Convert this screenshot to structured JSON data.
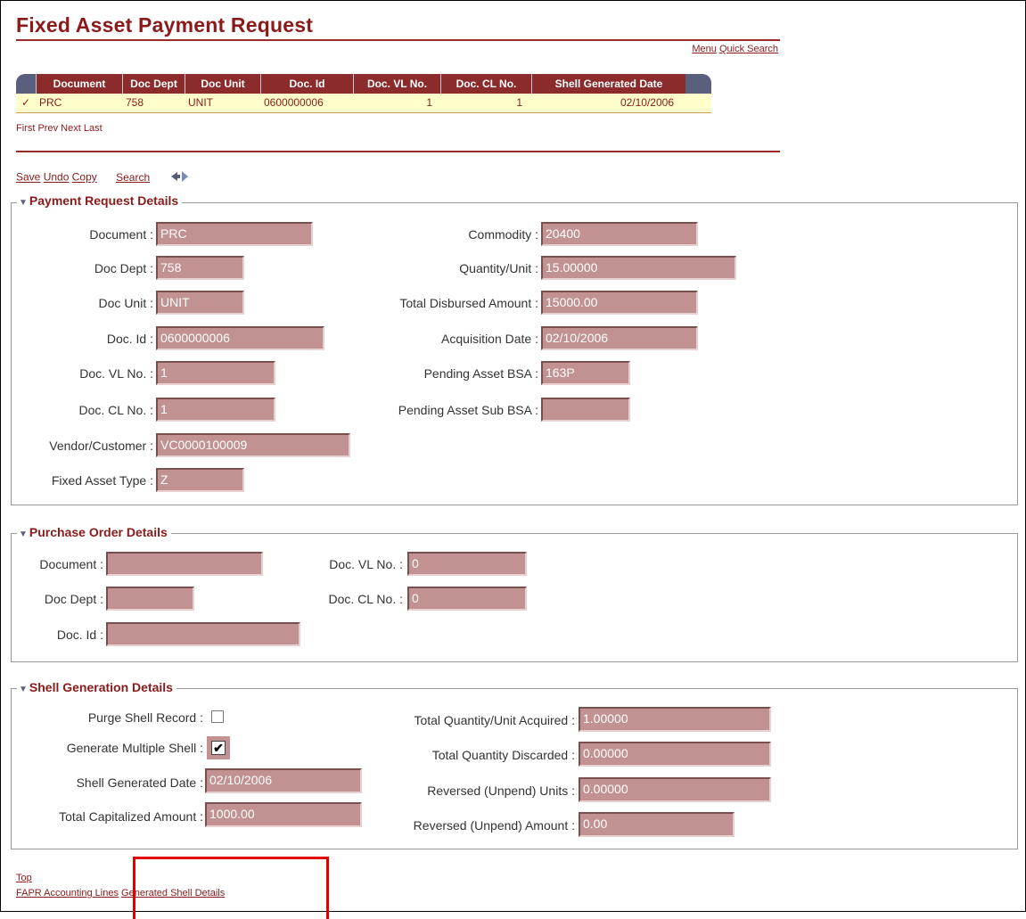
{
  "page_title": "Fixed Asset Payment Request",
  "top_links": {
    "menu": "Menu",
    "quick_search": "Quick Search"
  },
  "grid": {
    "columns": [
      "Document",
      "Doc Dept",
      "Doc Unit",
      "Doc. Id",
      "Doc. VL No.",
      "Doc. CL No.",
      "Shell Generated Date"
    ],
    "row": {
      "check": "✓",
      "document": "PRC",
      "doc_dept": "758",
      "doc_unit": "UNIT",
      "doc_id": "0600000006",
      "vl_no": "1",
      "cl_no": "1",
      "shell_date": "02/10/2006"
    }
  },
  "pager": {
    "first": "First",
    "prev": "Prev",
    "next": "Next",
    "last": "Last"
  },
  "toolbar": {
    "save": "Save",
    "undo": "Undo",
    "copy": "Copy",
    "search": "Search",
    "nav_icon": "navigate-icon"
  },
  "payment_request": {
    "legend": "Payment Request Details",
    "left": [
      {
        "label": "Document :",
        "value": "PRC"
      },
      {
        "label": "Doc Dept :",
        "value": "758"
      },
      {
        "label": "Doc Unit :",
        "value": "UNIT"
      },
      {
        "label": "Doc. Id :",
        "value": "0600000006"
      },
      {
        "label": "Doc. VL No. :",
        "value": "1"
      },
      {
        "label": "Doc. CL No. :",
        "value": "1"
      },
      {
        "label": "Vendor/Customer :",
        "value": "VC0000100009"
      },
      {
        "label": "Fixed Asset Type :",
        "value": "Z"
      }
    ],
    "right": [
      {
        "label": "Commodity :",
        "value": "20400"
      },
      {
        "label": "Quantity/Unit :",
        "value": "15.00000"
      },
      {
        "label": "Total Disbursed Amount :",
        "value": "15000.00"
      },
      {
        "label": "Acquisition Date :",
        "value": "02/10/2006"
      },
      {
        "label": "Pending Asset BSA :",
        "value": "163P"
      },
      {
        "label": "Pending Asset Sub BSA :",
        "value": ""
      }
    ]
  },
  "purchase_order": {
    "legend": "Purchase Order Details",
    "left": [
      {
        "label": "Document :",
        "value": ""
      },
      {
        "label": "Doc Dept :",
        "value": ""
      },
      {
        "label": "Doc. Id :",
        "value": ""
      }
    ],
    "right": [
      {
        "label": "Doc. VL No. :",
        "value": "0"
      },
      {
        "label": "Doc. CL No. :",
        "value": "0"
      }
    ]
  },
  "shell_generation": {
    "legend": "Shell Generation Details",
    "purge_label": "Purge Shell Record :",
    "generate_label": "Generate Multiple Shell :",
    "generate_checked": "✔",
    "shell_date_label": "Shell Generated Date :",
    "shell_date_value": "02/10/2006",
    "capitalized_label": "Total Capitalized Amount :",
    "capitalized_value": "1000.00",
    "right": [
      {
        "label": "Total Quantity/Unit Acquired :",
        "value": "1.00000"
      },
      {
        "label": "Total Quantity Discarded :",
        "value": "0.00000"
      },
      {
        "label": "Reversed (Unpend) Units :",
        "value": "0.00000"
      },
      {
        "label": "Reversed (Unpend) Amount :",
        "value": "0.00"
      }
    ]
  },
  "footer": {
    "top": "Top",
    "accounting_lines": "FAPR Accounting Lines",
    "shell_details": "Generated Shell Details"
  }
}
